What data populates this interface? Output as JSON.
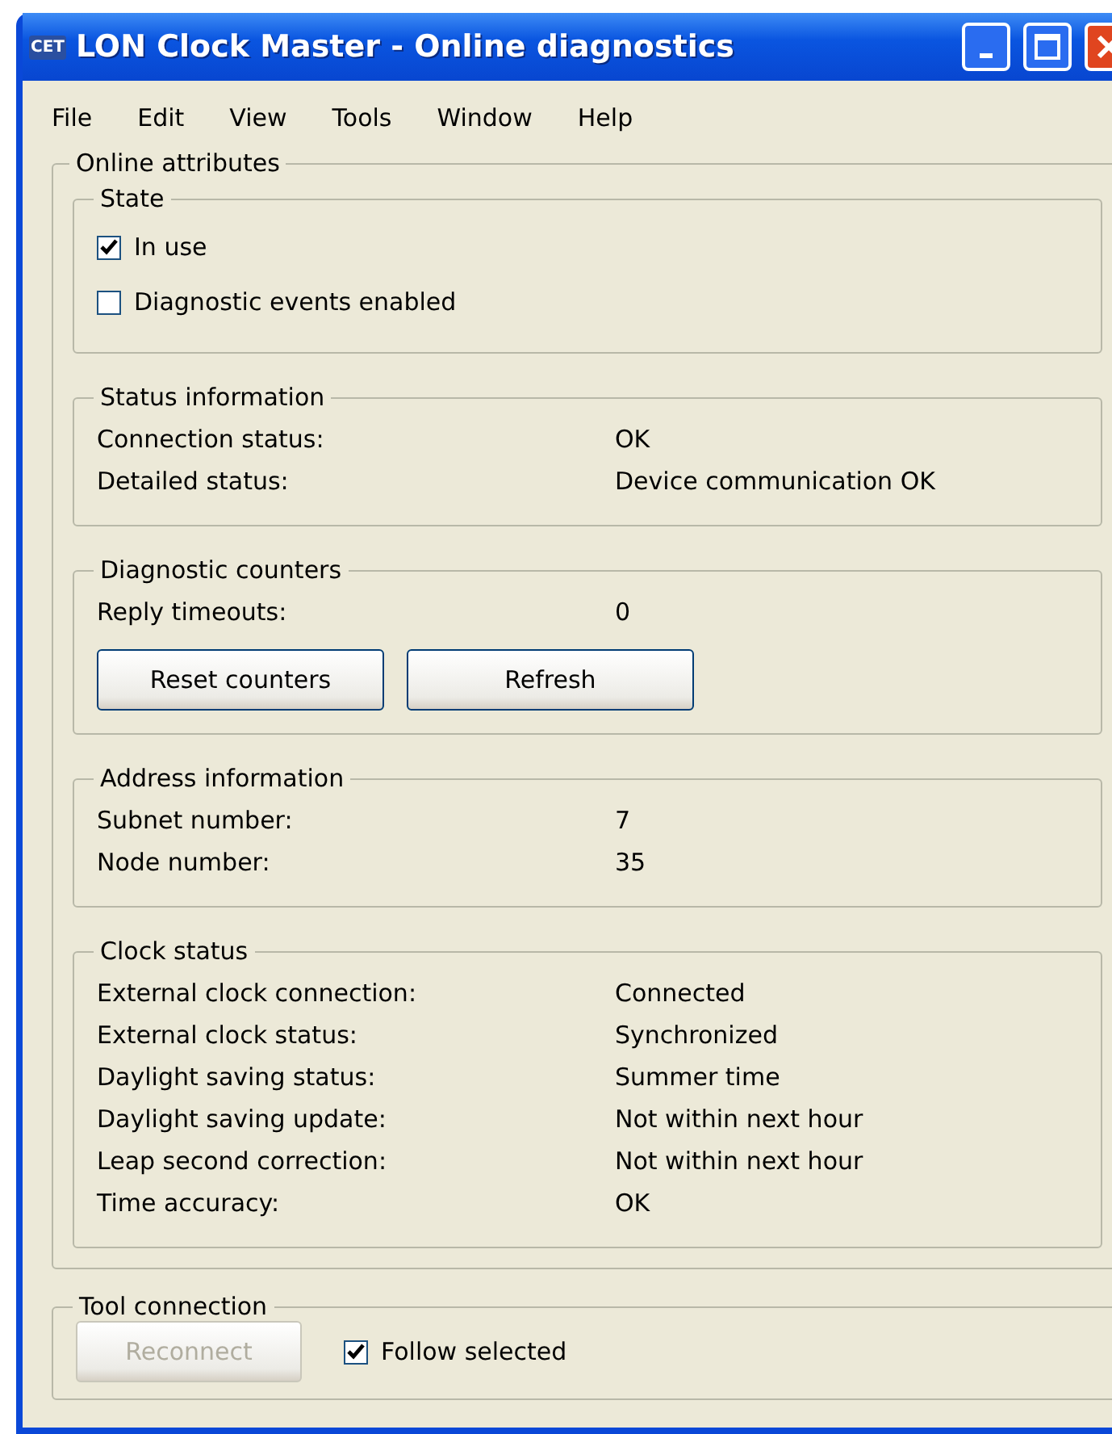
{
  "window": {
    "icon_label": "CET",
    "title": "LON Clock Master - Online diagnostics"
  },
  "menu": [
    "File",
    "Edit",
    "View",
    "Tools",
    "Window",
    "Help"
  ],
  "online_attributes": {
    "title": "Online attributes",
    "sections": [
      {
        "title": "State",
        "checks": [
          {
            "label": "In use",
            "checked": true
          },
          {
            "label": "Diagnostic events enabled",
            "checked": false
          }
        ]
      },
      {
        "title": "Status information",
        "rows": [
          {
            "label": "Connection status:",
            "value": "OK"
          },
          {
            "label": "Detailed status:",
            "value": "Device communication OK"
          }
        ]
      },
      {
        "title": "Diagnostic counters",
        "rows": [
          {
            "label": "Reply timeouts:",
            "value": "0"
          }
        ],
        "buttons": [
          {
            "label": "Reset counters",
            "disabled": false
          },
          {
            "label": "Refresh",
            "disabled": false
          }
        ]
      },
      {
        "title": "Address information",
        "rows": [
          {
            "label": "Subnet number:",
            "value": "7"
          },
          {
            "label": "Node number:",
            "value": "35"
          }
        ]
      },
      {
        "title": "Clock status",
        "rows": [
          {
            "label": "External clock connection:",
            "value": "Connected"
          },
          {
            "label": "External clock status:",
            "value": "Synchronized"
          },
          {
            "label": "Daylight saving status:",
            "value": "Summer time"
          },
          {
            "label": "Daylight saving update:",
            "value": "Not within next hour"
          },
          {
            "label": "Leap second correction:",
            "value": "Not within next hour"
          },
          {
            "label": "Time accuracy:",
            "value": "OK"
          }
        ]
      }
    ]
  },
  "tool_connection": {
    "title": "Tool connection",
    "button": {
      "label": "Reconnect",
      "disabled": true
    },
    "check": {
      "label": "Follow selected",
      "checked": true
    }
  }
}
